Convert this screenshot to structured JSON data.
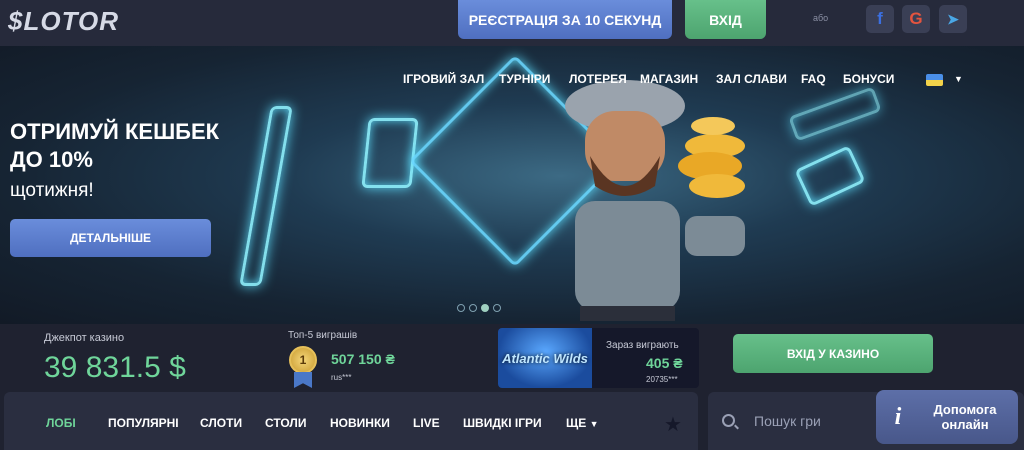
{
  "header": {
    "logo": "$LOTOR",
    "register_label": "РЕЄСТРАЦІЯ ЗА 10 СЕКУНД",
    "login_label": "ВХІД",
    "or_label": "або",
    "social": [
      {
        "icon": "facebook-icon",
        "glyph": "f",
        "color": "#3b6fe0"
      },
      {
        "icon": "google-icon",
        "glyph": "G",
        "color": "#e3543f"
      },
      {
        "icon": "telegram-icon",
        "glyph": "➤",
        "color": "#4aa7e6"
      }
    ]
  },
  "nav": {
    "items": [
      "ІГРОВИЙ ЗАЛ",
      "ТУРНІРИ",
      "ЛОТЕРЕЯ",
      "МАГАЗИН",
      "ЗАЛ СЛАВИ",
      "FAQ",
      "БОНУСИ"
    ],
    "language_icon": "ukraine-flag-icon"
  },
  "promo": {
    "title": "ОТРИМУЙ КЕШБЕК ДО 10%",
    "subtitle": "щотижня!",
    "button_label": "ДЕТАЛЬНІШЕ",
    "slides_total": 4,
    "active_slide": 3
  },
  "stats": {
    "jackpot_label": "Джекпот казино",
    "jackpot_value": "39 831.5 $",
    "top5_label": "Топ-5 виграшів",
    "top5_rank": "1",
    "top5_amount": "507 150 ₴",
    "top5_user": "rus***",
    "game_title": "Atlantic Wilds",
    "winning_label": "Зараз виграють",
    "winning_amount": "405 ₴",
    "winning_user": "20735***",
    "casino_button_label": "ВХІД У КАЗИНО"
  },
  "categories": {
    "items": [
      "ЛОБІ",
      "ПОПУЛЯРНІ",
      "СЛОТИ",
      "СТОЛИ",
      "НОВИНКИ",
      "LIVE",
      "ШВИДКІ ІГРИ",
      "ЩЕ"
    ],
    "active": "ЛОБІ"
  },
  "search": {
    "placeholder": "Пошук гри"
  },
  "help": {
    "icon": "info-icon",
    "label": "Допомога онлайн"
  },
  "colors": {
    "accent_green": "#6fd59a",
    "accent_blue": "#5b7dd0",
    "background": "#1f2230"
  }
}
